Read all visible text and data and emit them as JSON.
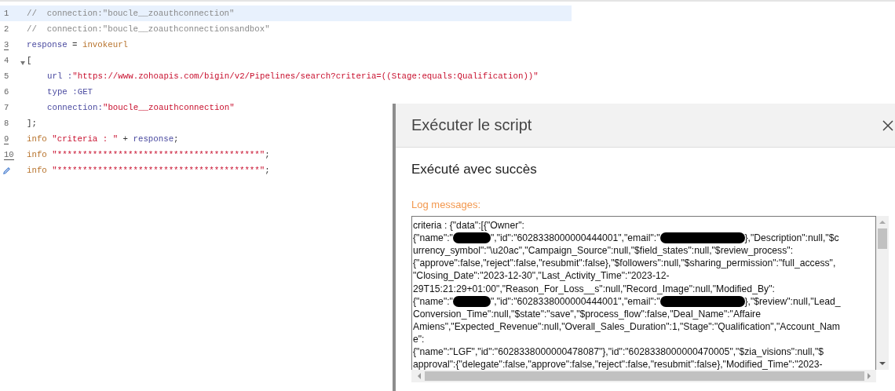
{
  "editor": {
    "lines": [
      {
        "number": "1",
        "highlighted": true,
        "underlined": false,
        "foldable": false,
        "indented": false,
        "tokens": [
          {
            "kind": "comment",
            "text": "//  connection:\"boucle__zoauthconnection\""
          }
        ]
      },
      {
        "number": "2",
        "highlighted": false,
        "underlined": false,
        "foldable": false,
        "indented": false,
        "tokens": [
          {
            "kind": "comment",
            "text": "//  connection:\"boucle__zoauthconnectionsandbox\""
          }
        ]
      },
      {
        "number": "3",
        "highlighted": false,
        "underlined": true,
        "foldable": false,
        "indented": false,
        "tokens": [
          {
            "kind": "variable",
            "text": "response"
          },
          {
            "kind": "plain",
            "text": " = "
          },
          {
            "kind": "keyword",
            "text": "invokeurl"
          }
        ]
      },
      {
        "number": "4",
        "highlighted": false,
        "underlined": false,
        "foldable": true,
        "indented": false,
        "tokens": [
          {
            "kind": "plain",
            "text": "["
          }
        ]
      },
      {
        "number": "5",
        "highlighted": false,
        "underlined": false,
        "foldable": false,
        "indented": true,
        "tokens": [
          {
            "kind": "variable",
            "text": "url :"
          },
          {
            "kind": "string",
            "text": "\"https://www.zohoapis.com/bigin/v2/Pipelines/search?criteria=((Stage:equals:Qualification))\""
          }
        ]
      },
      {
        "number": "6",
        "highlighted": false,
        "underlined": false,
        "foldable": false,
        "indented": true,
        "tokens": [
          {
            "kind": "variable",
            "text": "type :GET"
          }
        ]
      },
      {
        "number": "7",
        "highlighted": false,
        "underlined": false,
        "foldable": false,
        "indented": true,
        "tokens": [
          {
            "kind": "variable",
            "text": "connection:"
          },
          {
            "kind": "string",
            "text": "\"boucle__zoauthconnection\""
          }
        ]
      },
      {
        "number": "8",
        "highlighted": false,
        "underlined": false,
        "foldable": false,
        "indented": false,
        "tokens": [
          {
            "kind": "plain",
            "text": "];"
          }
        ]
      },
      {
        "number": "9",
        "highlighted": false,
        "underlined": true,
        "foldable": false,
        "indented": false,
        "tokens": [
          {
            "kind": "keyword",
            "text": "info "
          },
          {
            "kind": "string",
            "text": "\"criteria : \""
          },
          {
            "kind": "plain",
            "text": " + "
          },
          {
            "kind": "variable",
            "text": "response"
          },
          {
            "kind": "plain",
            "text": ";"
          }
        ]
      },
      {
        "number": "10",
        "highlighted": false,
        "underlined": true,
        "foldable": false,
        "indented": false,
        "tokens": [
          {
            "kind": "keyword",
            "text": "info "
          },
          {
            "kind": "string",
            "text": "\"****************************************\""
          },
          {
            "kind": "plain",
            "text": ";"
          }
        ]
      },
      {
        "highlighted": false,
        "underlined": false,
        "foldable": false,
        "indented": false,
        "tokens": [
          {
            "kind": "keyword",
            "text": "info "
          },
          {
            "kind": "string",
            "text": "\"****************************************\""
          },
          {
            "kind": "plain",
            "text": ";"
          }
        ]
      }
    ]
  },
  "dialog": {
    "title": "Exécuter le script",
    "status": "Exécuté avec succès",
    "log_label": "Log messages:",
    "log_lines": [
      [
        {
          "kind": "text",
          "text": "criteria : {\"data\":[{\"Owner\":"
        }
      ],
      [
        {
          "kind": "text",
          "text": "{\"name\":\""
        },
        {
          "kind": "mask"
        },
        {
          "kind": "text",
          "text": "\",\"id\":\"6028338000000444001\",\"email\":\""
        },
        {
          "kind": "longmask"
        },
        {
          "kind": "text",
          "text": "},\"Description\":null,\"$c"
        }
      ],
      [
        {
          "kind": "text",
          "text": "urrency_symbol\":\"\\u20ac\",\"Campaign_Source\":null,\"$field_states\":null,\"$review_process\":"
        }
      ],
      [
        {
          "kind": "text",
          "text": "{\"approve\":false,\"reject\":false,\"resubmit\":false},\"$followers\":null,\"$sharing_permission\":\"full_access\","
        }
      ],
      [
        {
          "kind": "text",
          "text": "\"Closing_Date\":\"2023-12-30\",\"Last_Activity_Time\":\"2023-12-"
        }
      ],
      [
        {
          "kind": "text",
          "text": "29T15:21:29+01:00\",\"Reason_For_Loss__s\":null,\"Record_Image\":null,\"Modified_By\":"
        }
      ],
      [
        {
          "kind": "text",
          "text": "{\"name\":\""
        },
        {
          "kind": "mask"
        },
        {
          "kind": "text",
          "text": "\",\"id\":\"6028338000000444001\",\"email\":\""
        },
        {
          "kind": "longmask"
        },
        {
          "kind": "text",
          "text": "},\"$review\":null,\"Lead_"
        }
      ],
      [
        {
          "kind": "text",
          "text": "Conversion_Time\":null,\"$state\":\"save\",\"$process_flow\":false,\"Deal_Name\":\"Affaire"
        }
      ],
      [
        {
          "kind": "text",
          "text": "Amiens\",\"Expected_Revenue\":null,\"Overall_Sales_Duration\":1,\"Stage\":\"Qualification\",\"Account_Nam"
        }
      ],
      [
        {
          "kind": "text",
          "text": "e\":"
        }
      ],
      [
        {
          "kind": "text",
          "text": "{\"name\":\"LGF\",\"id\":\"6028338000000478087\"},\"id\":\"6028338000000470005\",\"$zia_visions\":null,\"$"
        }
      ],
      [
        {
          "kind": "text",
          "text": "approval\":{\"delegate\":false,\"approve\":false,\"reject\":false,\"resubmit\":false},\"Modified_Time\":\"2023-"
        }
      ]
    ]
  }
}
